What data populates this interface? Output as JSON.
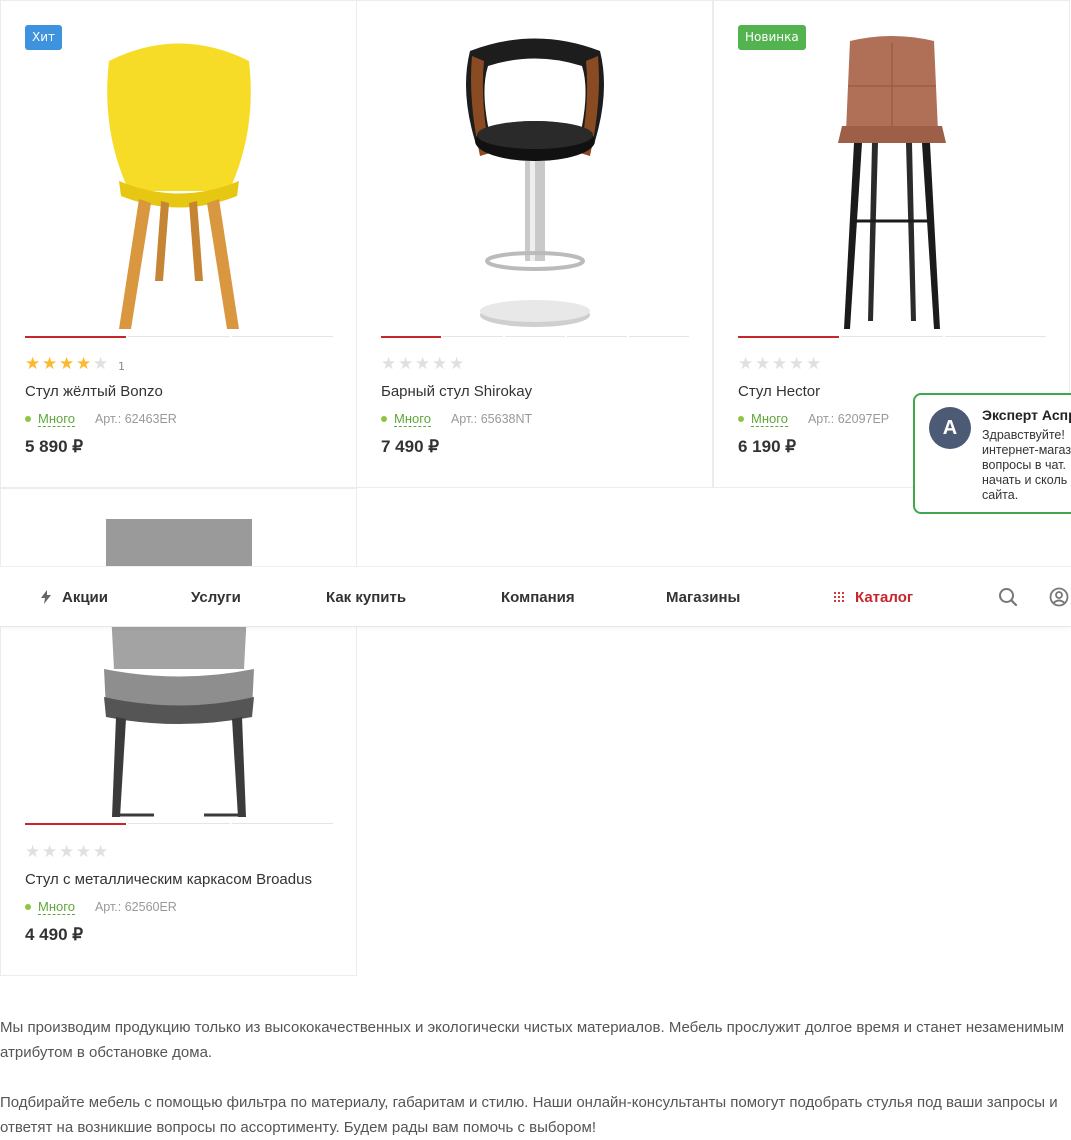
{
  "products": [
    {
      "badge": "Хит",
      "rating_count": "1",
      "title": "Стул жёлтый Bonzo",
      "stock": "Много",
      "article": "Арт.: 62463ER",
      "price": "5 890 ₽",
      "stars": 4,
      "image_icon": "yellow-chair-image"
    },
    {
      "badge": "",
      "rating_count": "",
      "title": "Барный стул Shirokay",
      "stock": "Много",
      "article": "Арт.: 65638NT",
      "price": "7 490 ₽",
      "stars": 0,
      "image_icon": "bar-stool-image"
    },
    {
      "badge": "Новинка",
      "rating_count": "",
      "title": "Стул Hector",
      "stock": "Много",
      "article": "Арт.: 62097EP",
      "price": "6 190 ₽",
      "stars": 0,
      "image_icon": "brown-bar-chair-image"
    },
    {
      "badge": "",
      "rating_count": "",
      "title": "Стул с металлическим каркасом Broadus",
      "stock": "Много",
      "article": "Арт.: 62560ER",
      "price": "4 490 ₽",
      "stars": 0,
      "image_icon": "grey-chair-image"
    }
  ],
  "nav": {
    "promo": "Акции",
    "services": "Услуги",
    "how_to_buy": "Как купить",
    "company": "Компания",
    "shops": "Магазины",
    "catalog": "Каталог"
  },
  "chat": {
    "avatar_letter": "A",
    "name": "Эксперт Аспр",
    "text": "Здравствуйте!\nинтернет-магаз\nвопросы в чат.\nначать и сколь\nсайта."
  },
  "description": {
    "p1": "Мы производим продукцию только из высококачественных и экологически чистых материалов. Мебель прослужит долгое время и станет незаменимым атрибутом в обстановке дома.",
    "p2": "Подбирайте мебель с помощью фильтра по материалу, габаритам и стилю. Наши онлайн-консультанты помогут подобрать стулья под ваши запросы и ответят на возникшие вопросы по ассортименту. Будем рады вам помочь с выбором!"
  },
  "colors": {
    "accent": "#c7262a",
    "badge_hit": "#3e93df",
    "badge_new": "#52b34f",
    "stock": "#5ea83a",
    "chat_border": "#3fa84d"
  }
}
